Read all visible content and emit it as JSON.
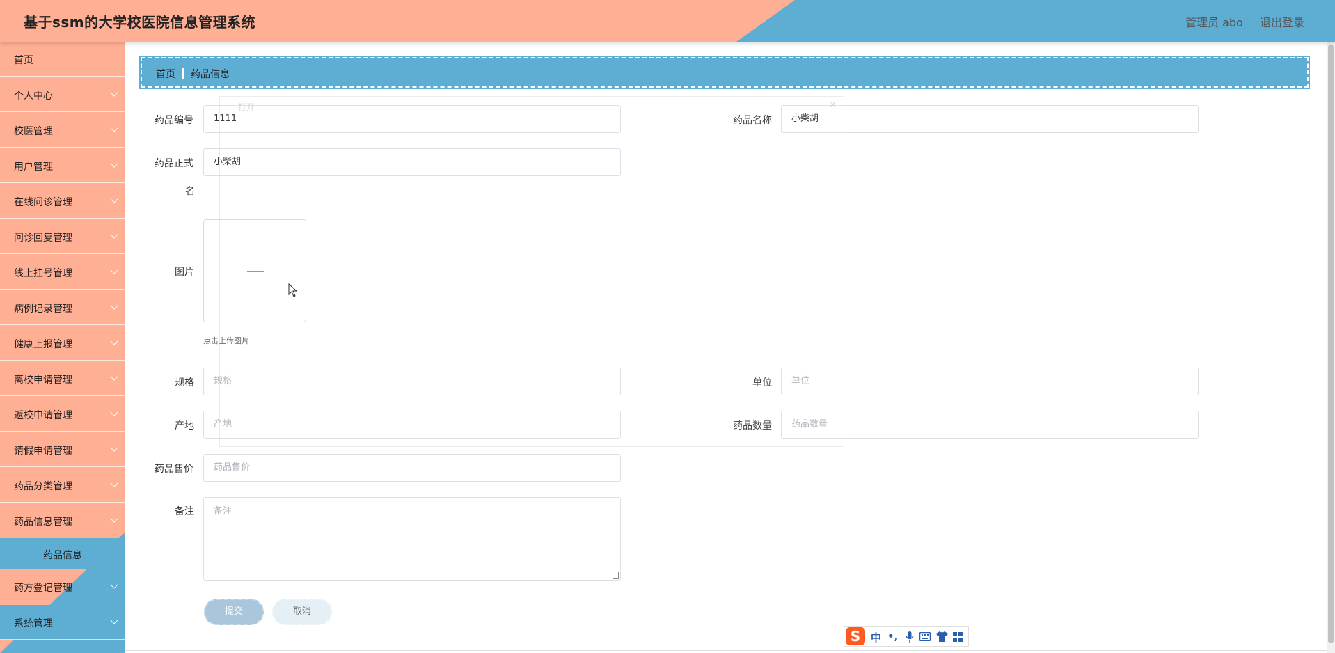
{
  "header": {
    "title": "基于ssm的大学校医院信息管理系统",
    "user": "管理员 abo",
    "logout": "退出登录"
  },
  "sidebar": {
    "items": [
      {
        "label": "首页"
      },
      {
        "label": "个人中心"
      },
      {
        "label": "校医管理"
      },
      {
        "label": "用户管理"
      },
      {
        "label": "在线问诊管理"
      },
      {
        "label": "问诊回复管理"
      },
      {
        "label": "线上挂号管理"
      },
      {
        "label": "病例记录管理"
      },
      {
        "label": "健康上报管理"
      },
      {
        "label": "离校申请管理"
      },
      {
        "label": "返校申请管理"
      },
      {
        "label": "请假申请管理"
      },
      {
        "label": "药品分类管理"
      },
      {
        "label": "药品信息管理"
      },
      {
        "label": "药方登记管理"
      },
      {
        "label": "系统管理"
      }
    ],
    "active_submenu": "药品信息"
  },
  "breadcrumb": {
    "home": "首页",
    "current": "药品信息"
  },
  "form": {
    "drug_code": {
      "label": "药品编号",
      "value": "1111"
    },
    "drug_name": {
      "label": "药品名称",
      "value": "小柴胡"
    },
    "official_name": {
      "label_line1": "药品正式",
      "label_line2": "名",
      "value": "小柴胡"
    },
    "image": {
      "label": "图片",
      "tip": "点击上传图片"
    },
    "spec": {
      "label": "规格",
      "placeholder": "规格"
    },
    "unit": {
      "label": "单位",
      "placeholder": "单位"
    },
    "origin": {
      "label": "产地",
      "placeholder": "产地"
    },
    "quantity": {
      "label": "药品数量",
      "placeholder": "药品数量"
    },
    "price": {
      "label": "药品售价",
      "placeholder": "药品售价"
    },
    "remark": {
      "label": "备注",
      "placeholder": "备注"
    },
    "submit": "提交",
    "cancel": "取消"
  },
  "ghost_dialog": {
    "title": "打开",
    "close": "×"
  },
  "ime": {
    "logo": "S",
    "mode": "中",
    "punct": "•,"
  },
  "colors": {
    "peach": "#ffaf94",
    "blue": "#5eadd3"
  }
}
